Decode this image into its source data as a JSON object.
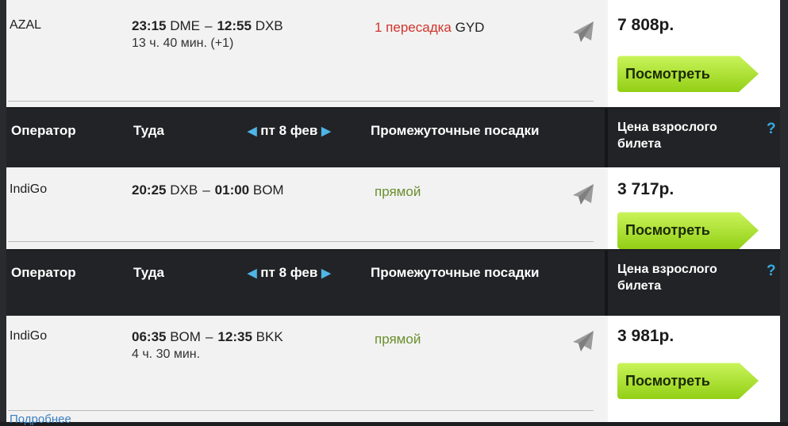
{
  "headers": {
    "operator": "Оператор",
    "direction": "Туда",
    "date": "пт 8 фев",
    "stops": "Промежуточные посадки",
    "price": "Цена взрослого билета",
    "help": "?",
    "arrow_left": "◀",
    "arrow_right": "▶"
  },
  "dash": "–",
  "button_label": "Посмотреть",
  "flights": [
    {
      "operator": "AZAL",
      "dep_time": "23:15",
      "dep_code": "DME",
      "arr_time": "12:55",
      "arr_code": "DXB",
      "duration": "13 ч. 40 мин. (+1)",
      "stops": "1 пересадка",
      "stop_code": "GYD",
      "price": "7 808р."
    },
    {
      "operator": "IndiGo",
      "dep_time": "20:25",
      "dep_code": "DXB",
      "arr_time": "01:00",
      "arr_code": "BOM",
      "duration": "",
      "stops": "прямой",
      "price": "3 717р."
    },
    {
      "operator": "IndiGo",
      "dep_time": "06:35",
      "dep_code": "BOM",
      "arr_time": "12:35",
      "arr_code": "BKK",
      "duration": "4 ч. 30 мин.",
      "stops": "прямой",
      "price": "3 981р."
    }
  ],
  "footer_link": "Подробнее",
  "colors": {
    "transfer_red": "#d0342c",
    "direct_green": "#6b8f2e",
    "button_green": "#93cf16",
    "header_bg": "#222326",
    "arrow_blue": "#4fb4e6"
  }
}
